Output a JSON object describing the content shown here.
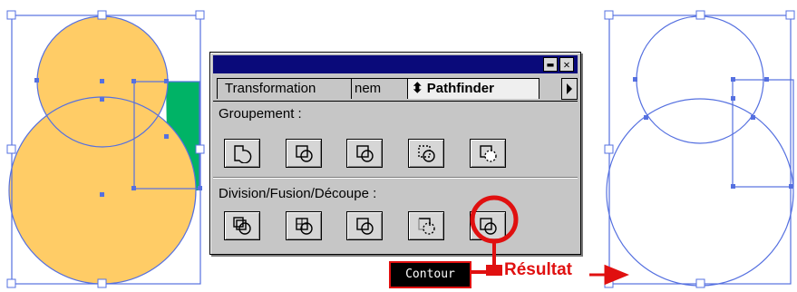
{
  "panel": {
    "tabs": [
      {
        "label": "Transformation",
        "active": false
      },
      {
        "label": "nem",
        "active": false
      },
      {
        "label": "Pathfinder",
        "active": true
      }
    ],
    "active_tab_prefix_icon": "updown-icon",
    "window_controls": {
      "minimize": "▬",
      "close": "✕"
    },
    "sections": [
      {
        "label": "Groupement :",
        "buttons": [
          "unite-icon",
          "intersection-icon",
          "exclusion-icon",
          "soustraction-icon",
          "soustraire-arriere-icon"
        ]
      },
      {
        "label": "Division/Fusion/Découpe :",
        "buttons": [
          "division-icon",
          "fusion-icon",
          "decouper-icon",
          "detourage-icon",
          "contour-icon"
        ]
      }
    ]
  },
  "annotations": {
    "tooltip": "Contour",
    "result_label": "Résultat",
    "highlight_color": "#e01010"
  },
  "colors": {
    "fill_orange": "#ffcc66",
    "fill_green": "#00b366",
    "selection_blue": "#5570e0",
    "title_bar": "#0a0a7a"
  }
}
